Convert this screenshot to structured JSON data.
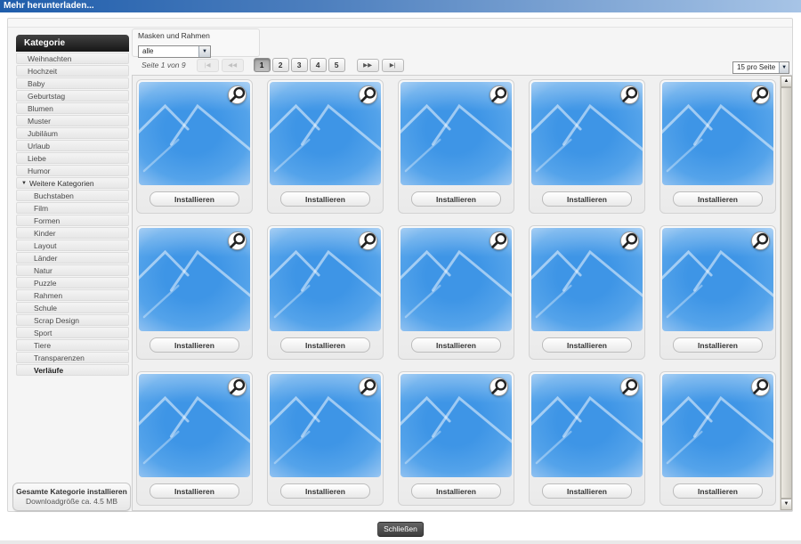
{
  "window": {
    "title": "Mehr herunterladen...",
    "close_label": "Schließen"
  },
  "sidebar": {
    "header": "Kategorie",
    "items": [
      {
        "label": "Weihnachten"
      },
      {
        "label": "Hochzeit"
      },
      {
        "label": "Baby"
      },
      {
        "label": "Geburtstag"
      },
      {
        "label": "Blumen"
      },
      {
        "label": "Muster"
      },
      {
        "label": "Jubiläum"
      },
      {
        "label": "Urlaub"
      },
      {
        "label": "Liebe"
      },
      {
        "label": "Humor"
      },
      {
        "label": "Weitere Kategorien",
        "expander": true
      },
      {
        "label": "Buchstaben",
        "sub": true
      },
      {
        "label": "Film",
        "sub": true
      },
      {
        "label": "Formen",
        "sub": true
      },
      {
        "label": "Kinder",
        "sub": true
      },
      {
        "label": "Layout",
        "sub": true
      },
      {
        "label": "Länder",
        "sub": true
      },
      {
        "label": "Natur",
        "sub": true
      },
      {
        "label": "Puzzle",
        "sub": true
      },
      {
        "label": "Rahmen",
        "sub": true
      },
      {
        "label": "Schule",
        "sub": true
      },
      {
        "label": "Scrap Design",
        "sub": true
      },
      {
        "label": "Sport",
        "sub": true
      },
      {
        "label": "Tiere",
        "sub": true
      },
      {
        "label": "Transparenzen",
        "sub": true
      },
      {
        "label": "Verläufe",
        "sub": true,
        "selected": true
      }
    ],
    "install_all": {
      "title": "Gesamte Kategorie installieren",
      "subtitle": "Downloadgröße ca. 4.5 MB"
    }
  },
  "filter": {
    "label": "Masken und Rahmen",
    "value": "alle",
    "arrow_icon": "▼"
  },
  "pagination": {
    "status": "Seite 1 von 9",
    "first_label": "|◀",
    "prev_label": "◀◀",
    "pages": [
      "1",
      "2",
      "3",
      "4",
      "5"
    ],
    "active": "1",
    "next_label": "▶▶",
    "last_label": "▶|"
  },
  "page_size": {
    "value": "15 pro Seite",
    "arrow_icon": "▼"
  },
  "grid": {
    "cards": 15,
    "install_label": "Installieren"
  },
  "scrollbar": {
    "up_icon": "▲",
    "down_icon": "▼"
  },
  "colors": {
    "titlebar_start": "#1f5dab",
    "titlebar_end": "#a7c4e6",
    "thumb_blue": "#3e95e6",
    "sidebar_header_bg": "#1a1a1a"
  }
}
